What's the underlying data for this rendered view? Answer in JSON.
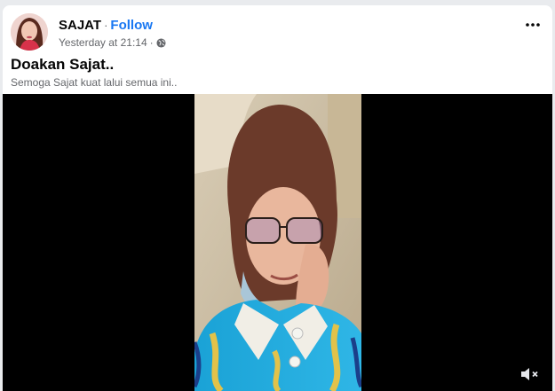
{
  "post": {
    "author": "SAJAT",
    "separator": "·",
    "follow_label": "Follow",
    "timestamp": "Yesterday at 21:14",
    "meta_separator": "·",
    "privacy_icon": "globe-icon",
    "more_icon": "more-options-icon",
    "title": "Doakan Sajat..",
    "caption": "Semoga Sajat kuat lalui semua ini..",
    "video": {
      "mute_icon": "volume-muted-icon"
    }
  },
  "colors": {
    "link_blue": "#1877f2",
    "meta_gray": "#65676b",
    "video_background": "#000000"
  }
}
